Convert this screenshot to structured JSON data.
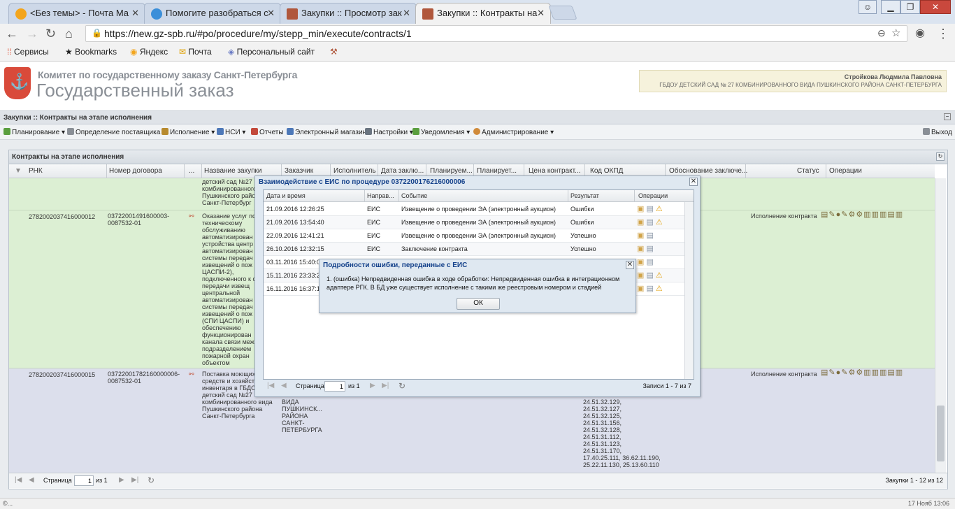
{
  "browser": {
    "tabs": [
      {
        "title": "<Без темы> - Почта Ма",
        "icon": "mail-ru-icon"
      },
      {
        "title": "Помогите разобраться с",
        "icon": "globe-icon"
      },
      {
        "title": "Закупки :: Просмотр зак",
        "icon": "hammer-icon"
      },
      {
        "title": "Закупки :: Контракты на",
        "icon": "hammer-icon"
      }
    ],
    "url": "https://new.gz-spb.ru/#po/procedure/my/stepp_min/execute/contracts/1",
    "bookmarks": [
      "Сервисы",
      "Bookmarks",
      "Яндекс",
      "Почта",
      "Персональный сайт"
    ]
  },
  "app": {
    "org_line1": "Комитет по государственному заказу Санкт-Петербурга",
    "org_line2": "Государственный заказ",
    "user_name": "Стройкова Людмила Павловна",
    "user_org": "ГБДОУ ДЕТСКИЙ САД № 27 КОМБИНИРОВАННОГО ВИДА ПУШКИНСКОГО РАЙОНА САНКТ-ПЕТЕРБУРГА",
    "breadcrumb": "Закупки :: Контракты на этапе исполнения",
    "menu": [
      "Планирование ▾",
      "Определение поставщика ▾",
      "Исполнение ▾",
      "НСИ ▾",
      "Отчеты",
      "Электронный магазин",
      "Настройки ▾",
      "Уведомления ▾",
      "Администрирование ▾"
    ],
    "logout": "Выход"
  },
  "grid": {
    "title": "Контракты на этапе исполнения",
    "columns": [
      "РНК",
      "Номер договора",
      "...",
      "Название закупки",
      "Заказчик",
      "Исполнитель",
      "Дата заклю...",
      "Планируем...",
      "Планирует...",
      "Цена контракт...",
      "Код ОКПД",
      "Обоснование заключе...",
      "Статус",
      "Операции"
    ],
    "row0_text": "детский сад №27\nкомбинированного\nПушкинского райо\nСанкт-Петербург",
    "row1": {
      "rnk": "2782002037416000012",
      "number": "03722001491600003-\n0087532-01",
      "name": "Оказание услуг по\nтехническому\nобслуживанию\nавтоматизирован\nустройства центр\nавтоматизирован\nсистемы передач\nизвещений о пож\nЦАСПИ-2),\nподключенного к с\nпередачи извещ\nцентральной\nавтоматизирован\nсистемы передач\nизвещений о пож\n(СПИ ЦАСПИ) и\nобеспечению\nфункционирован\nканала связи меж\nподразделением\nпожарной охран\nобъектом",
      "status": "Исполнение контракта"
    },
    "row2": {
      "rnk": "2782002037416000015",
      "number": "03722001782160000006-\n0087532-01",
      "name": "Поставка моющих\nсредств и хозяйст\nинвентаря в ГБДО\nдетский сад №27\nкомбинированного вида\nПушкинского района\nСанкт-Петербурга",
      "customer": "ВИДА\nПУШКИНСК...\nРАЙОНА\nСАНКТ-\nПЕТЕРБУРГА",
      "okpd": "24.51.32.129,\n24.51.32.127,\n24.51.32.125,\n24.51.31.156,\n24.51.32.128,\n24.51.31.112,\n24.51.31.123,\n24.51.31.170,\n17.40.25.111, 36.62.11.190,\n25.22.11.130, 25.13.60.110",
      "status": "Исполнение контракта"
    },
    "pager": {
      "page_label": "Страница",
      "page": "1",
      "of": "из 1",
      "summary": "Закупки 1 - 12 из 12"
    }
  },
  "dialog_eis": {
    "title": "Взаимодействие с ЕИС по процедуре 0372200176216000006",
    "columns": [
      "Дата и время",
      "Направ...",
      "Событие",
      "Результат",
      "Операции"
    ],
    "rows": [
      {
        "dt": "21.09.2016 12:26:25",
        "dir": "ЕИС",
        "event": "Извещение о проведении ЭА (электронный аукцион)",
        "result": "Ошибки",
        "warn": true
      },
      {
        "dt": "21.09.2016 13:54:40",
        "dir": "ЕИС",
        "event": "Извещение о проведении ЭА (электронный аукцион)",
        "result": "Ошибки",
        "warn": true
      },
      {
        "dt": "22.09.2016 12:41:21",
        "dir": "ЕИС",
        "event": "Извещение о проведении ЭА (электронный аукцион)",
        "result": "Успешно",
        "warn": false
      },
      {
        "dt": "26.10.2016 12:32:15",
        "dir": "ЕИС",
        "event": "Заключение контракта",
        "result": "Успешно",
        "warn": false
      },
      {
        "dt": "03.11.2016 15:40:0",
        "dir": "",
        "event": "",
        "result": "",
        "warn": false
      },
      {
        "dt": "15.11.2016 23:33:2",
        "dir": "",
        "event": "",
        "result": "",
        "warn": true
      },
      {
        "dt": "16.11.2016 16:37:1",
        "dir": "",
        "event": "",
        "result": "",
        "warn": true
      }
    ],
    "pager": {
      "page_label": "Страница",
      "page": "1",
      "of": "из 1",
      "summary": "Записи 1 - 7 из 7"
    }
  },
  "dialog_error": {
    "title": "Подробности ошибки, переданные с ЕИС",
    "message": "1. (ошибка) Непредвиденная ошибка в ходе обработки: Непредвиденная ошибка в интеграционном адаптере РГК. В БД уже существует исполнение с такими же реестровым номером и стадией",
    "ok": "ОК"
  },
  "statusbar": {
    "left": "©...",
    "right": "17 Нояб 13:06"
  },
  "colors": {
    "row_selected": "#dcefd3",
    "row_normal": "#dcdfec",
    "dialog_title": "#15428b"
  }
}
